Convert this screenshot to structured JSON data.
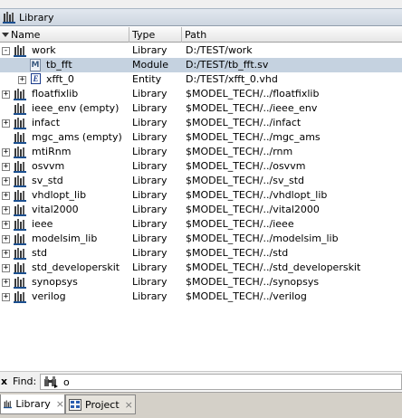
{
  "window": {
    "title": "Library"
  },
  "columns": {
    "name": "Name",
    "type": "Type",
    "path": "Path"
  },
  "rows": [
    {
      "name": "work",
      "type": "Library",
      "path": "D:/TEST/work",
      "icon": "library-icon",
      "expander": "-",
      "depth": 0
    },
    {
      "name": "tb_fft",
      "type": "Module",
      "path": "D:/TEST/tb_fft.sv",
      "icon": "module-icon",
      "expander": "",
      "depth": 1,
      "selected": true
    },
    {
      "name": "xfft_0",
      "type": "Entity",
      "path": "D:/TEST/xfft_0.vhd",
      "icon": "entity-icon",
      "expander": "+",
      "depth": 1
    },
    {
      "name": "floatfixlib",
      "type": "Library",
      "path": "$MODEL_TECH/../floatfixlib",
      "icon": "library-icon",
      "expander": "+",
      "depth": 0
    },
    {
      "name": "ieee_env  (empty)",
      "type": "Library",
      "path": "$MODEL_TECH/../ieee_env",
      "icon": "library-icon",
      "expander": "",
      "depth": 0
    },
    {
      "name": "infact",
      "type": "Library",
      "path": "$MODEL_TECH/../infact",
      "icon": "library-icon",
      "expander": "+",
      "depth": 0
    },
    {
      "name": "mgc_ams  (empty)",
      "type": "Library",
      "path": "$MODEL_TECH/../mgc_ams",
      "icon": "library-icon",
      "expander": "",
      "depth": 0
    },
    {
      "name": "mtiRnm",
      "type": "Library",
      "path": "$MODEL_TECH/../rnm",
      "icon": "library-icon",
      "expander": "+",
      "depth": 0
    },
    {
      "name": "osvvm",
      "type": "Library",
      "path": "$MODEL_TECH/../osvvm",
      "icon": "library-icon",
      "expander": "+",
      "depth": 0
    },
    {
      "name": "sv_std",
      "type": "Library",
      "path": "$MODEL_TECH/../sv_std",
      "icon": "library-icon",
      "expander": "+",
      "depth": 0
    },
    {
      "name": "vhdlopt_lib",
      "type": "Library",
      "path": "$MODEL_TECH/../vhdlopt_lib",
      "icon": "library-icon",
      "expander": "+",
      "depth": 0
    },
    {
      "name": "vital2000",
      "type": "Library",
      "path": "$MODEL_TECH/../vital2000",
      "icon": "library-icon",
      "expander": "+",
      "depth": 0
    },
    {
      "name": "ieee",
      "type": "Library",
      "path": "$MODEL_TECH/../ieee",
      "icon": "library-icon",
      "expander": "+",
      "depth": 0
    },
    {
      "name": "modelsim_lib",
      "type": "Library",
      "path": "$MODEL_TECH/../modelsim_lib",
      "icon": "library-icon",
      "expander": "+",
      "depth": 0
    },
    {
      "name": "std",
      "type": "Library",
      "path": "$MODEL_TECH/../std",
      "icon": "library-icon",
      "expander": "+",
      "depth": 0
    },
    {
      "name": "std_developerskit",
      "type": "Library",
      "path": "$MODEL_TECH/../std_developerskit",
      "icon": "library-icon",
      "expander": "+",
      "depth": 0
    },
    {
      "name": "synopsys",
      "type": "Library",
      "path": "$MODEL_TECH/../synopsys",
      "icon": "library-icon",
      "expander": "+",
      "depth": 0
    },
    {
      "name": "verilog",
      "type": "Library",
      "path": "$MODEL_TECH/../verilog",
      "icon": "library-icon",
      "expander": "+",
      "depth": 0
    }
  ],
  "find": {
    "close": "x",
    "label": "Find:",
    "value": "o",
    "icon": "binoculars-icon"
  },
  "tabs": [
    {
      "label": "Library",
      "icon": "library-icon",
      "close": "×",
      "active": true
    },
    {
      "label": "Project",
      "icon": "project-icon",
      "close": "×",
      "active": false
    }
  ],
  "colors": {
    "selection": "#c5d2e0",
    "titlebar": "#d6dde6",
    "tabbar": "#d4d0c8"
  }
}
